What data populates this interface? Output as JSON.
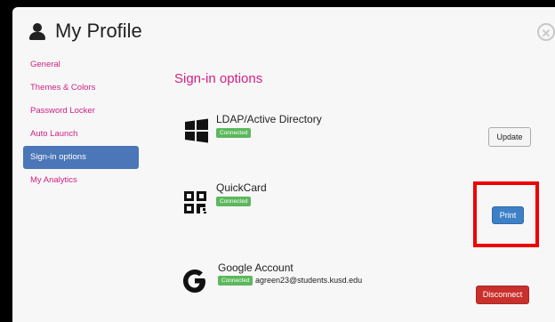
{
  "header": {
    "title": "My Profile",
    "user_icon": "user-icon",
    "close_icon": "close-circle-icon"
  },
  "sidebar": {
    "items": [
      {
        "label": "General",
        "active": false
      },
      {
        "label": "Themes & Colors",
        "active": false
      },
      {
        "label": "Password Locker",
        "active": false
      },
      {
        "label": "Auto Launch",
        "active": false
      },
      {
        "label": "Sign-in options",
        "active": true
      },
      {
        "label": "My Analytics",
        "active": false
      }
    ]
  },
  "main": {
    "section_title": "Sign-in options",
    "providers": [
      {
        "name": "LDAP/Active Directory",
        "icon": "windows-icon",
        "status": "Connected",
        "button": "Update"
      },
      {
        "name": "QuickCard",
        "icon": "qr-code-icon",
        "status": "Connected",
        "button": "Print"
      },
      {
        "name": "Google Account",
        "icon": "google-icon",
        "status": "Connected",
        "account": "agreen23@students.kusd.edu",
        "button": "Disconnect"
      }
    ]
  },
  "colors": {
    "accent": "#d21f84",
    "active_nav": "#4b76b8",
    "connected": "#5cb85c",
    "primary": "#3d80c7",
    "danger": "#c9302c",
    "highlight": "#ee0000"
  }
}
